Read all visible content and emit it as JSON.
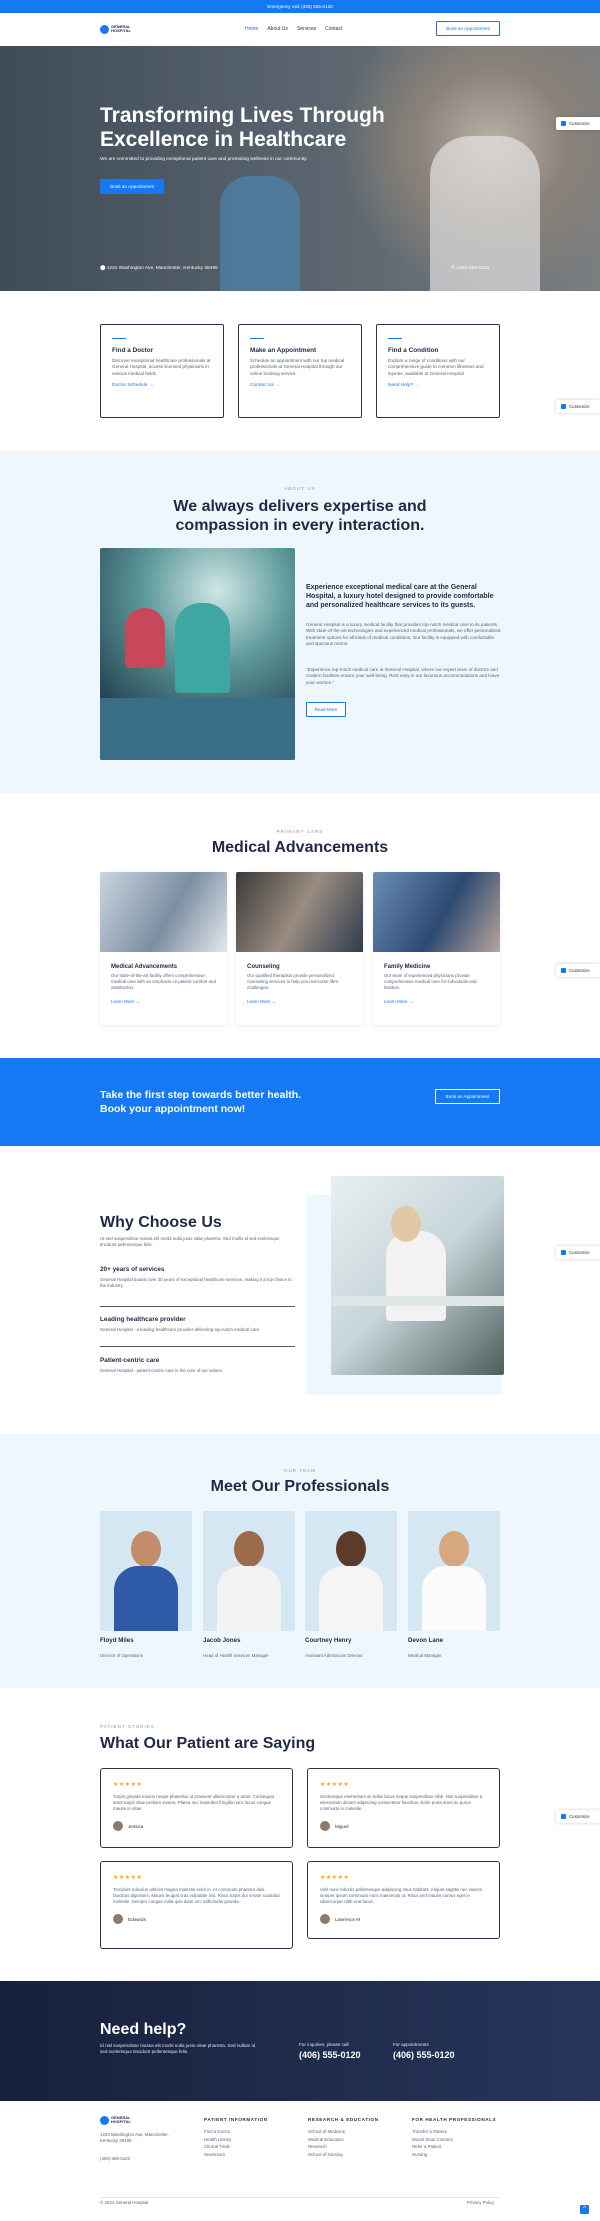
{
  "topbar": {
    "text": "Emergency call: (406) 555-0120"
  },
  "brand": {
    "line1": "GENERAL",
    "line2": "HOSPITAL",
    "accent": "#1479f2"
  },
  "nav": {
    "links": [
      "Home",
      "About Us",
      "Services",
      "Contact"
    ],
    "cta": "Book an Appointment"
  },
  "hero": {
    "title": "Transforming Lives Through Excellence in Healthcare",
    "subtitle": "We are committed to providing exceptional patient care and promoting wellness in our community.",
    "button": "Book an Appointment",
    "address": "1234 Washington Ave, Manchester, Kentucky 39495",
    "phone": "(406) 555-0120"
  },
  "customize": "Customize",
  "services": [
    {
      "title": "Find a Doctor",
      "text": "Discover exceptional healthcare professionals at General Hospital, access licensed physicians in various medical fields.",
      "link": "Doctor Schedule"
    },
    {
      "title": "Make an Appointment",
      "text": "Schedule an appointment with our top medical professionals at General Hospital through our online booking service.",
      "link": "Contact Us"
    },
    {
      "title": "Find a Condition",
      "text": "Explore a range of conditions with our comprehensive guide to common illnesses and injuries, available at General Hospital",
      "link": "Need Help?"
    }
  ],
  "about": {
    "eyebrow": "ABOUT US",
    "title": "We always delivers expertise and compassion in every interaction.",
    "heading": "Experience exceptional medical care at the General Hospital, a luxury hotel designed to provide comfortable and personalized healthcare services to its guests.",
    "para1": "General Hospital is a luxury medical facility that provides top-notch medical care to its patients. With state-of-the-art technologies and experienced medical professionals, we offer personalized treatment options for all kinds of medical conditions. Our facility is equipped with comfortable and spacious rooms.",
    "para2": "\"Experience top-notch medical care at General Hospital, where our expert team of doctors and modern facilities ensure your well-being. Rest easy in our luxurious accommodations and leave your worries.\"",
    "button": "Read More"
  },
  "primary": {
    "eyebrow": "PRIMARY CARE",
    "title": "Medical Advancements",
    "cards": [
      {
        "title": "Medical Advancements",
        "text": "Our state-of-the-art facility offers comprehensive medical care with an emphasis on patient comfort and satisfaction.",
        "link": "Learn More"
      },
      {
        "title": "Counseling",
        "text": "Our qualified therapists provide personalized counseling services to help you overcome life's challenges.",
        "link": "Learn More"
      },
      {
        "title": "Family Medicine",
        "text": "Our team of experienced physicians provide comprehensive medical care for individuals and families.",
        "link": "Learn More"
      }
    ]
  },
  "cta": {
    "text": "Take the first step towards better health. Book your appointment now!",
    "button": "Book an Appointment"
  },
  "why": {
    "title": "Why Choose Us",
    "intro": "Ut sed suspendisse massa elit morbi nulla justo vitae pharetra. Sed mollis id sed scelerisque tincidunt pellentesque felis.",
    "items": [
      {
        "title": "20+ years of services",
        "text": "General Hospital boasts over 20 years of exceptional healthcare services, making it a top choice in the industry."
      },
      {
        "title": "Leading healthcare provider",
        "text": "General Hospital - a leading healthcare provider delivering top-notch medical care."
      },
      {
        "title": "Patient-centric care",
        "text": "General Hospital - patient-centric care is the core of our values."
      }
    ]
  },
  "team": {
    "eyebrow": "OUR TEAM",
    "title": "Meet Our Professionals",
    "members": [
      {
        "name": "Floyd Miles",
        "role": "Director of Operations"
      },
      {
        "name": "Jacob Jones",
        "role": "Head of Health Services Manager"
      },
      {
        "name": "Courtney Henry",
        "role": "Assistant Admissions Director"
      },
      {
        "name": "Devon Lane",
        "role": "Medical Manager"
      }
    ]
  },
  "testimonials": {
    "eyebrow": "PATIENT STORIES",
    "title": "What Our Patient are Saying",
    "items": [
      {
        "stars": "★★★★★",
        "text": "Turpis gravida mauris neque phasellus ut praesent ullamcorper a amet. Consequat amet turpis vitae pretium viverra. Platea nec imperdiet fringilla nunc lacus congue mauris in vitae.",
        "name": "Jessica"
      },
      {
        "stars": "★★★★★",
        "text": "Scelerisque elementum ac tellus lacus neque suspendisse nibh. Nisl suspendisse a elementum dictum adipiscing consectetur faucibus. Enim porta amet ac purus commodo in molestie.",
        "name": "Miguel"
      },
      {
        "stars": "★★★★★",
        "text": "Tincidunt ridiculus ultrices magna molestie enim in. At commodo pharetra duis faucibus dignissim. Mauris feugiat cras vulputate nisi. Risus turpis dui ornare curabitur molestie. Semper congue nulla quis diam orci sollicitudin gravida.",
        "name": "Edwards"
      },
      {
        "stars": "★★★★★",
        "text": "Velit nunc lobortis pellentesque adipiscing risus habitant. Aliquet sagittis nec viverra semper ipsum commodo nunc maecenas ut. Risus sed mauris curvus eget in ullamcorper nibh erat lacus.",
        "name": "Lawrence M"
      }
    ]
  },
  "help": {
    "title": "Need help?",
    "text": "Id nisl suspendisse massa elit morbi nulla justo vitae pharetra. Sed nullam id sed scelerisque tincidunt pellentesque felis.",
    "label1": "For inquiries, please call",
    "phone1": "(406) 555-0120",
    "label2": "For appointments",
    "phone2": "(406) 555-0120"
  },
  "footer": {
    "address": "1234 Washington Ave, Manchester, Kentucky 39495",
    "phone": "(406) 555-0120",
    "cols": [
      {
        "title": "PATIENT INFORMATION",
        "links": [
          "Find a Doctor",
          "Health Library",
          "Clinical Trials",
          "Newsroom"
        ]
      },
      {
        "title": "RESEARCH & EDUCATION",
        "links": [
          "School of Medicine",
          "Medical Education",
          "Research",
          "School of Nursing"
        ]
      },
      {
        "title": "FOR HEALTH PROFESSIONALS",
        "links": [
          "Transfer a Patient",
          "Mount Sinai Connect",
          "Refer a Patient",
          "Nursing"
        ]
      }
    ],
    "copyright": "© 2024 General Hospital",
    "privacy": "Privacy Policy"
  }
}
